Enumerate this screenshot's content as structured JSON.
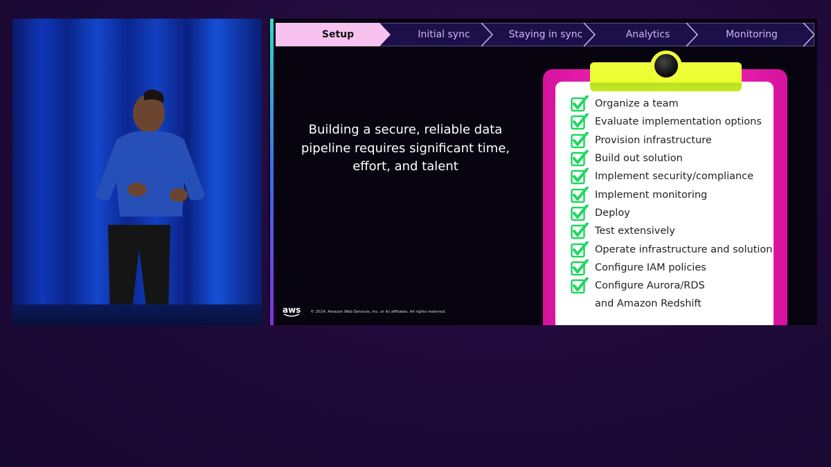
{
  "steps": [
    {
      "label": "Setup",
      "active": true
    },
    {
      "label": "Initial sync"
    },
    {
      "label": "Staying in sync"
    },
    {
      "label": "Analytics"
    },
    {
      "label": "Monitoring"
    }
  ],
  "headline": "Building a secure, reliable data pipeline requires significant time, effort, and talent",
  "checklist": [
    {
      "label": "Organize a team",
      "checked": true
    },
    {
      "label": "Evaluate implementation options",
      "checked": true
    },
    {
      "label": "Provision infrastructure",
      "checked": true
    },
    {
      "label": "Build out solution",
      "checked": true
    },
    {
      "label": "Implement security/compliance",
      "checked": true
    },
    {
      "label": "Implement monitoring",
      "checked": true
    },
    {
      "label": "Deploy",
      "checked": true
    },
    {
      "label": "Test extensively",
      "checked": true
    },
    {
      "label": "Operate infrastructure and solution",
      "checked": true
    },
    {
      "label": "Configure IAM policies",
      "checked": true
    },
    {
      "label": "Configure Aurora/RDS",
      "checked": true
    },
    {
      "label": "and Amazon Redshift",
      "checked": false
    }
  ],
  "footer": {
    "logo": "aws",
    "copyright": "© 2024, Amazon Web Services, Inc. or its affiliates. All rights reserved."
  },
  "colors": {
    "active_step": "#f7c2f0",
    "step_bg": "#1d0f4a",
    "check": "#1ed760",
    "clipboard": "#ff2ec4",
    "clip": "#f2ff3c"
  }
}
